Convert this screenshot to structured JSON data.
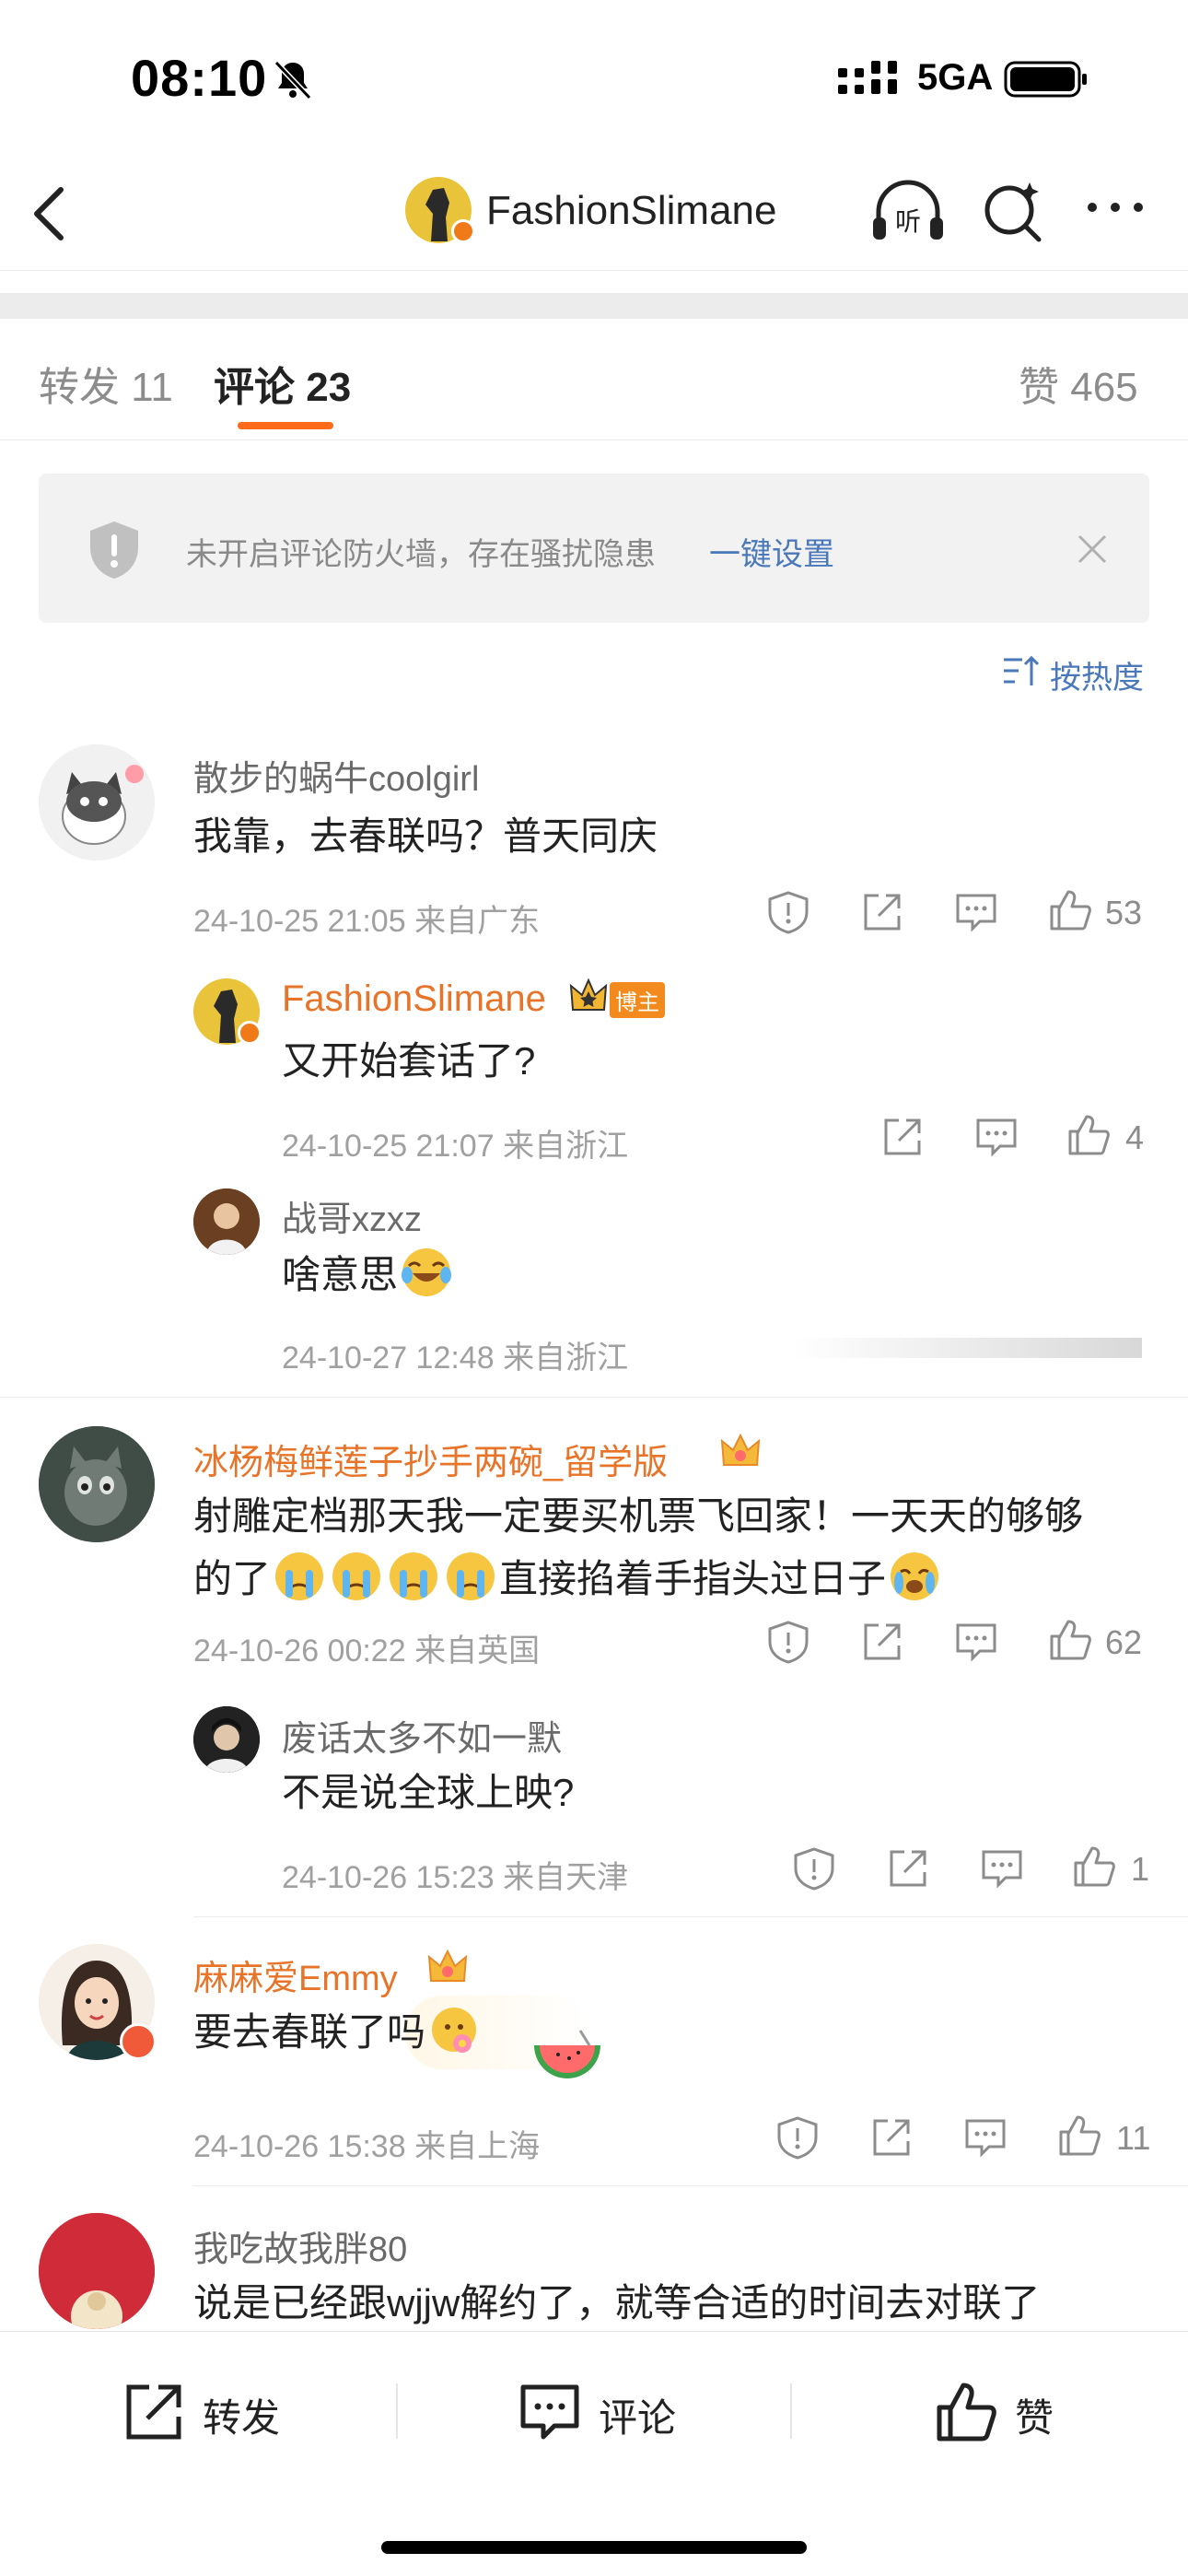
{
  "status": {
    "time": "08:10",
    "network": "5GA"
  },
  "nav": {
    "title": "FashionSlimane"
  },
  "tabs": [
    {
      "label": "转发 11"
    },
    {
      "label": "评论 23"
    },
    {
      "label": "赞 465"
    }
  ],
  "firewall": {
    "text": "未开启评论防火墙，存在骚扰隐患",
    "link": "一键设置"
  },
  "sort": {
    "label": "按热度"
  },
  "comments": [
    {
      "name": "散步的蜗牛coolgirl",
      "text": "我靠，去春联吗？普天同庆",
      "meta": "24-10-25 21:05  来自广东",
      "likes": "53",
      "replies": [
        {
          "name": "FashionSlimane",
          "badge": "博主",
          "text": "又开始套话了?",
          "meta": "24-10-25 21:07  来自浙江",
          "likes": "4"
        },
        {
          "name": "战哥xzxz",
          "text": "啥意思",
          "meta": "24-10-27 12:48  来自浙江"
        }
      ]
    },
    {
      "name": "冰杨梅鲜莲子抄手两碗_留学版",
      "text_line1": "射雕定档那天我一定要买机票飞回家！一天天的够够",
      "text_line2a": "的了",
      "text_line2b": "直接掐着手指头过日子",
      "meta": "24-10-26 00:22  来自英国",
      "likes": "62",
      "replies": [
        {
          "name": "废话太多不如一默",
          "text": "不是说全球上映?",
          "meta": "24-10-26 15:23  来自天津",
          "likes": "1"
        }
      ]
    },
    {
      "name": "麻麻爱Emmy",
      "text": "要去春联了吗",
      "meta": "24-10-26 15:38  来自上海",
      "likes": "11"
    },
    {
      "name": "我吃故我胖80",
      "text": "说是已经跟wjjw解约了，就等合适的时间去对联了"
    }
  ],
  "bottom": {
    "repost": "转发",
    "comment": "评论",
    "like": "赞"
  },
  "colors": {
    "accent": "#ff6b1a",
    "link": "#4a78b8",
    "orange_name": "#e8742a"
  }
}
